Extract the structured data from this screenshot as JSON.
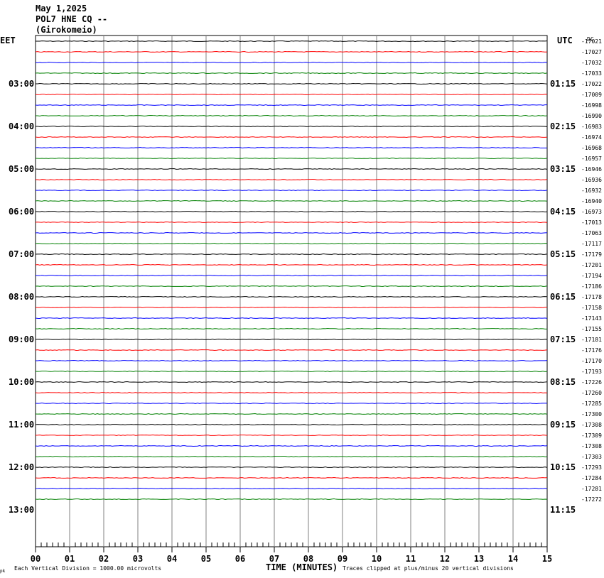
{
  "header": {
    "date": "May 1,2025",
    "station": "POL7 HNE CQ --",
    "location": "(Girokomeio)"
  },
  "left_axis_label": "EET",
  "right_axis_label": "UTC",
  "dc_label": "DC",
  "footer": {
    "scale_note": "Each Vertical Division = 1000.00 microvolts",
    "xlabel": "TIME (MINUTES)",
    "clip_note": "Traces clipped at plus/minus 20 vertical divisions",
    "corner_mark": "pk"
  },
  "colors": {
    "cycle": [
      "#000000",
      "#ff0000",
      "#0000ff",
      "#008000"
    ],
    "grid": "#808080"
  },
  "chart_data": {
    "type": "line",
    "title": "POL7 HNE CQ -- (Girokomeio)",
    "xlabel": "TIME (MINUTES)",
    "xlim": [
      0,
      15
    ],
    "x_ticks": [
      "00",
      "01",
      "02",
      "03",
      "04",
      "05",
      "06",
      "07",
      "08",
      "09",
      "10",
      "11",
      "12",
      "13",
      "14",
      "15"
    ],
    "left_time_labels": [
      "03:00",
      "04:00",
      "05:00",
      "06:00",
      "07:00",
      "08:00",
      "09:00",
      "10:00",
      "11:00",
      "12:00",
      "13:00"
    ],
    "right_time_labels": [
      "01:15",
      "02:15",
      "03:15",
      "04:15",
      "05:15",
      "06:15",
      "07:15",
      "08:15",
      "09:15",
      "10:15",
      "11:15"
    ],
    "dc_offsets": [
      -17021,
      -17027,
      -17032,
      -17033,
      -17022,
      -17009,
      -16998,
      -16990,
      -16983,
      -16974,
      -16968,
      -16957,
      -16946,
      -16936,
      -16932,
      -16940,
      -16973,
      -17013,
      -17063,
      -17117,
      -17179,
      -17201,
      -17194,
      -17186,
      -17178,
      -17158,
      -17143,
      -17155,
      -17181,
      -17176,
      -17170,
      -17193,
      -17226,
      -17260,
      -17285,
      -17300,
      -17308,
      -17309,
      -17308,
      -17303,
      -17293,
      -17284,
      -17281,
      -17272
    ],
    "trace_count": 44,
    "traces_per_hour": 4,
    "grid": true
  }
}
